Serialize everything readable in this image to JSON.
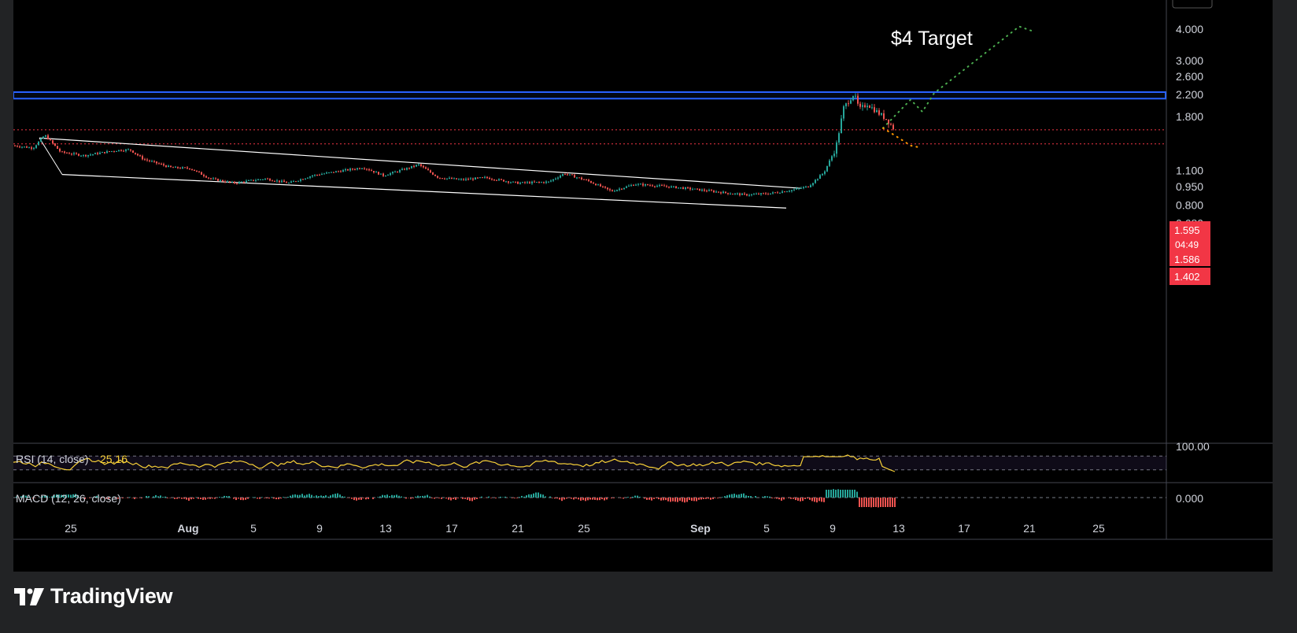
{
  "brand": {
    "name": "TradingView",
    "icon": "tradingview-logo-icon"
  },
  "colors": {
    "background": "#000000",
    "frame": "#222325",
    "up_candle": "#26a69a",
    "down_candle": "#ef5350",
    "resistance_zone": "#2962ff",
    "wedge_lines": "#ffffff",
    "support_lines": "#f23645",
    "projection_up": "#4caf50",
    "projection_down": "#ff9800",
    "rsi_line": "#f7d038",
    "price_badge": "#f23645"
  },
  "chart_data": {
    "type": "candlestick",
    "y_scale": "log",
    "price_axis_ticks": [
      "4.000",
      "3.000",
      "2.600",
      "2.200",
      "1.800",
      "1.100",
      "0.950",
      "0.800",
      "0.680"
    ],
    "price_badges": {
      "last_price": "1.595",
      "countdown": "04:49",
      "line_price": "1.586",
      "support_price": "1.402"
    },
    "date_ticks": [
      "25",
      "Aug",
      "5",
      "9",
      "13",
      "17",
      "21",
      "25",
      "Sep",
      "5",
      "9",
      "13",
      "17",
      "21",
      "25"
    ],
    "annotation": "$4 Target",
    "resistance_zone": [
      2.12,
      2.25
    ],
    "support_lines": [
      1.595,
      1.402
    ],
    "price_path": [
      [
        0,
        1.38
      ],
      [
        25,
        1.35
      ],
      [
        40,
        1.52
      ],
      [
        60,
        1.3
      ],
      [
        90,
        1.26
      ],
      [
        130,
        1.32
      ],
      [
        148,
        1.33
      ],
      [
        165,
        1.22
      ],
      [
        200,
        1.13
      ],
      [
        225,
        1.12
      ],
      [
        250,
        1.02
      ],
      [
        280,
        0.98
      ],
      [
        320,
        1.02
      ],
      [
        350,
        0.98
      ],
      [
        380,
        1.05
      ],
      [
        420,
        1.1
      ],
      [
        445,
        1.13
      ],
      [
        470,
        1.05
      ],
      [
        500,
        1.12
      ],
      [
        515,
        1.16
      ],
      [
        540,
        1.03
      ],
      [
        570,
        1.01
      ],
      [
        600,
        1.03
      ],
      [
        640,
        0.98
      ],
      [
        680,
        0.99
      ],
      [
        700,
        1.07
      ],
      [
        730,
        1.0
      ],
      [
        760,
        0.91
      ],
      [
        790,
        0.97
      ],
      [
        830,
        0.95
      ],
      [
        860,
        0.93
      ],
      [
        900,
        0.9
      ],
      [
        930,
        0.88
      ],
      [
        960,
        0.89
      ],
      [
        990,
        0.92
      ],
      [
        1010,
        0.95
      ],
      [
        1030,
        1.08
      ],
      [
        1045,
        1.35
      ],
      [
        1055,
        1.95
      ],
      [
        1068,
        2.22
      ],
      [
        1075,
        1.92
      ],
      [
        1085,
        2.02
      ],
      [
        1100,
        1.85
      ],
      [
        1110,
        1.75
      ],
      [
        1120,
        1.59
      ]
    ],
    "wedge": {
      "upper": [
        [
          33,
          1.48
        ],
        [
          1000,
          0.935
        ]
      ],
      "lower": [
        [
          62,
          1.06
        ],
        [
          982,
          0.78
        ]
      ]
    },
    "projection_up": [
      [
        1105,
        1.62
      ],
      [
        1140,
        2.1
      ],
      [
        1155,
        1.88
      ],
      [
        1170,
        2.23
      ],
      [
        1278,
        4.1
      ],
      [
        1296,
        3.92
      ]
    ],
    "projection_down": [
      [
        1105,
        1.62
      ],
      [
        1128,
        1.46
      ],
      [
        1140,
        1.38
      ],
      [
        1150,
        1.36
      ]
    ],
    "rsi": {
      "label": "RSI (14, close)",
      "value": "25.16",
      "axis_tick": "100.00",
      "upper_band": 70,
      "lower_band": 30
    },
    "macd": {
      "label": "MACD (12, 26, close)",
      "axis_tick": "0.000"
    }
  }
}
